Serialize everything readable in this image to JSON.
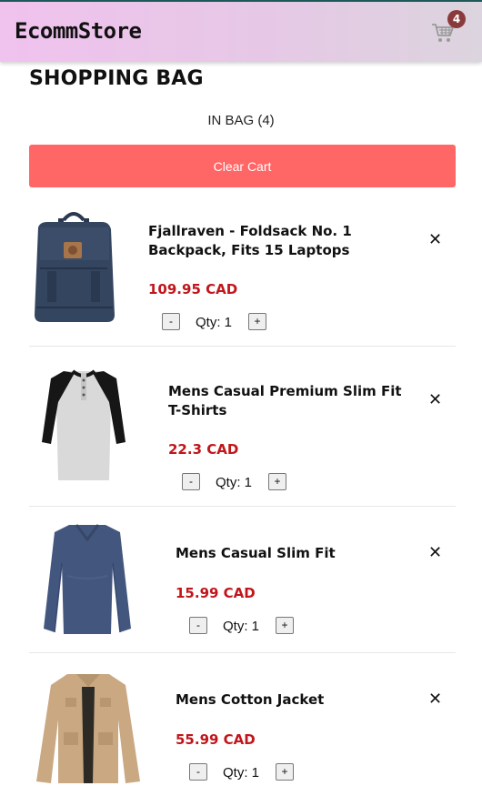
{
  "header": {
    "brand": "EcommStore",
    "cart_count": "4"
  },
  "page": {
    "title": "SHOPPING BAG",
    "in_bag": "IN BAG (4)",
    "clear_label": "Clear Cart"
  },
  "items": [
    {
      "name": "Fjallraven - Foldsack No. 1 Backpack, Fits 15 Laptops",
      "price": "109.95 CAD",
      "qty": "Qty: 1",
      "minus": "-",
      "plus": "+",
      "remove": "✕"
    },
    {
      "name": "Mens Casual Premium Slim Fit T-Shirts",
      "price": "22.3 CAD",
      "qty": "Qty: 1",
      "minus": "-",
      "plus": "+",
      "remove": "✕"
    },
    {
      "name": "Mens Casual Slim Fit",
      "price": "15.99 CAD",
      "qty": "Qty: 1",
      "minus": "-",
      "plus": "+",
      "remove": "✕"
    },
    {
      "name": "Mens Cotton Jacket",
      "price": "55.99 CAD",
      "qty": "Qty: 1",
      "minus": "-",
      "plus": "+",
      "remove": "✕"
    }
  ],
  "colors": {
    "accent": "#ff6666",
    "price": "#c0161b",
    "badge": "#8a3a3a"
  },
  "icons": {
    "cart": "shopping-cart-icon",
    "remove": "close-icon"
  }
}
